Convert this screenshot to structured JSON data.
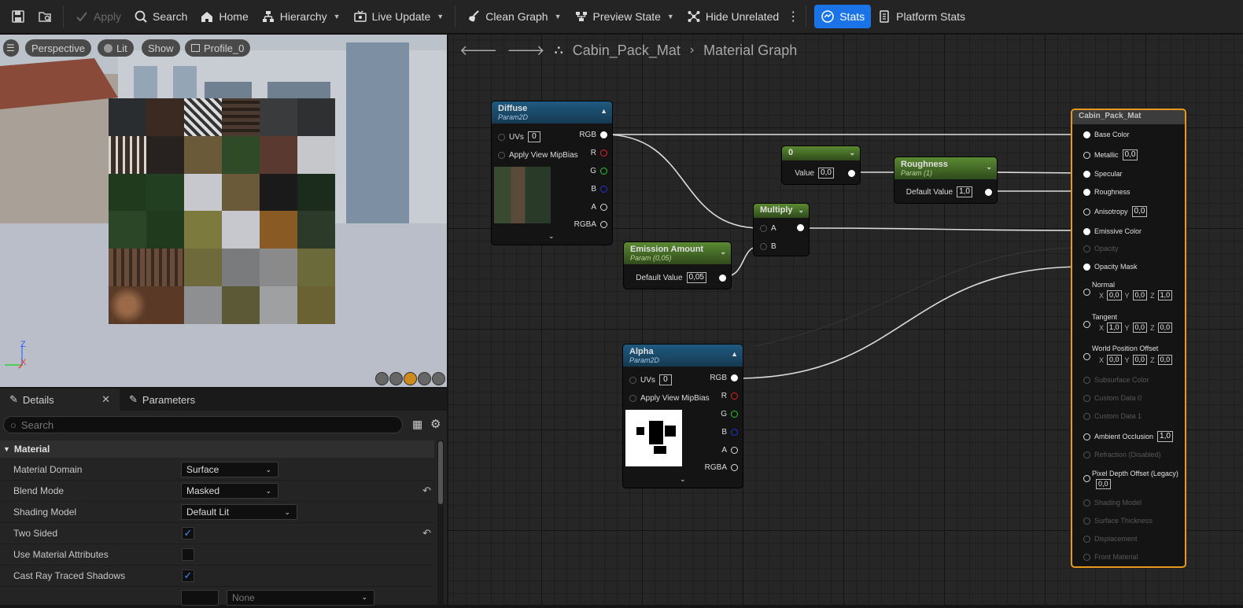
{
  "toolbar": {
    "apply": "Apply",
    "search": "Search",
    "home": "Home",
    "hierarchy": "Hierarchy",
    "live_update": "Live Update",
    "clean_graph": "Clean Graph",
    "preview_state": "Preview State",
    "hide_unrelated": "Hide Unrelated",
    "stats": "Stats",
    "platform_stats": "Platform Stats"
  },
  "viewport": {
    "perspective": "Perspective",
    "lit": "Lit",
    "show": "Show",
    "profile": "Profile_0",
    "axis_z": "Z",
    "axis_x": "X"
  },
  "panel": {
    "tab_details": "Details",
    "tab_parameters": "Parameters",
    "search_placeholder": "Search",
    "category": "Material",
    "rows": [
      {
        "label": "Material Domain",
        "value": "Surface"
      },
      {
        "label": "Blend Mode",
        "value": "Masked"
      },
      {
        "label": "Shading Model",
        "value": "Default Lit"
      },
      {
        "label": "Two Sided",
        "checked": true
      },
      {
        "label": "Use Material Attributes",
        "checked": false
      },
      {
        "label": "Cast Ray Traced Shadows",
        "checked": true
      }
    ],
    "partial_value": "None"
  },
  "graph": {
    "breadcrumb_asset": "Cabin_Pack_Mat",
    "breadcrumb_graph": "Material Graph",
    "diffuse": {
      "title": "Diffuse",
      "subtitle": "Param2D",
      "uvs_label": "UVs",
      "uvs_value": "0",
      "mipbias": "Apply View MipBias",
      "outputs": [
        "RGB",
        "R",
        "G",
        "B",
        "A",
        "RGBA"
      ]
    },
    "alpha": {
      "title": "Alpha",
      "subtitle": "Param2D",
      "uvs_label": "UVs",
      "uvs_value": "0",
      "mipbias": "Apply View MipBias",
      "outputs": [
        "RGB",
        "R",
        "G",
        "B",
        "A",
        "RGBA"
      ]
    },
    "const": {
      "title": "0",
      "value_label": "Value",
      "value": "0,0"
    },
    "roughness": {
      "title": "Roughness",
      "subtitle": "Param (1)",
      "label": "Default Value",
      "value": "1,0"
    },
    "multiply": {
      "title": "Multiply",
      "a": "A",
      "b": "B"
    },
    "emission": {
      "title": "Emission Amount",
      "subtitle": "Param (0,05)",
      "label": "Default Value",
      "value": "0,05"
    },
    "result": {
      "title": "Cabin_Pack_Mat",
      "pins": [
        {
          "label": "Base Color",
          "enabled": true
        },
        {
          "label": "Metallic",
          "enabled": true,
          "value": "0,0"
        },
        {
          "label": "Specular",
          "enabled": true
        },
        {
          "label": "Roughness",
          "enabled": true
        },
        {
          "label": "Anisotropy",
          "enabled": true,
          "value": "0,0"
        },
        {
          "label": "Emissive Color",
          "enabled": true
        },
        {
          "label": "Opacity",
          "enabled": false
        },
        {
          "label": "Opacity Mask",
          "enabled": true
        },
        {
          "label": "Normal",
          "enabled": true,
          "x": "0,0",
          "y": "0,0",
          "z": "1,0"
        },
        {
          "label": "Tangent",
          "enabled": true,
          "x": "1,0",
          "y": "0,0",
          "z": "0,0"
        },
        {
          "label": "World Position Offset",
          "enabled": true,
          "x": "0,0",
          "y": "0,0",
          "z": "0,0"
        },
        {
          "label": "Subsurface Color",
          "enabled": false
        },
        {
          "label": "Custom Data 0",
          "enabled": false
        },
        {
          "label": "Custom Data 1",
          "enabled": false
        },
        {
          "label": "Ambient Occlusion",
          "enabled": true,
          "value": "1,0"
        },
        {
          "label": "Refraction (Disabled)",
          "enabled": false
        },
        {
          "label": "Pixel Depth Offset (Legacy)",
          "enabled": true,
          "value": "0,0"
        },
        {
          "label": "Shading Model",
          "enabled": false
        },
        {
          "label": "Surface Thickness",
          "enabled": false
        },
        {
          "label": "Displacement",
          "enabled": false
        },
        {
          "label": "Front Material",
          "enabled": false
        }
      ],
      "axis_x": "X",
      "axis_y": "Y",
      "axis_z": "Z"
    }
  },
  "colors": {
    "accent": "#1a74e8",
    "result_border": "#e89a1e",
    "texture_header": "#1e5a80",
    "param_header": "#5a8a32"
  }
}
